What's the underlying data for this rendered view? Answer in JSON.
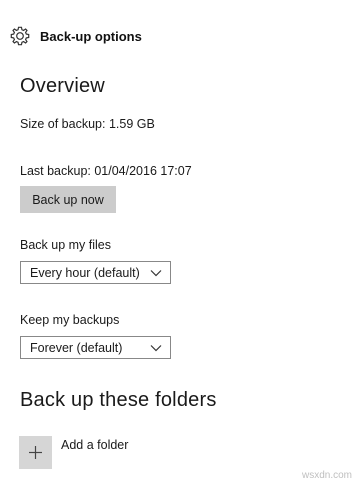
{
  "header": {
    "icon": "gear-icon",
    "title": "Back-up options"
  },
  "overview": {
    "heading": "Overview",
    "size_text": "Size of backup: 1.59 GB",
    "last_backup_text": "Last backup: 01/04/2016 17:07",
    "backup_now_label": "Back up now"
  },
  "frequency": {
    "label": "Back up my files",
    "selected": "Every hour (default)"
  },
  "retention": {
    "label": "Keep my backups",
    "selected": "Forever (default)"
  },
  "folders": {
    "heading": "Back up these folders",
    "add_icon": "plus-icon",
    "add_label": "Add a folder"
  },
  "watermark": "wsxdn.com"
}
